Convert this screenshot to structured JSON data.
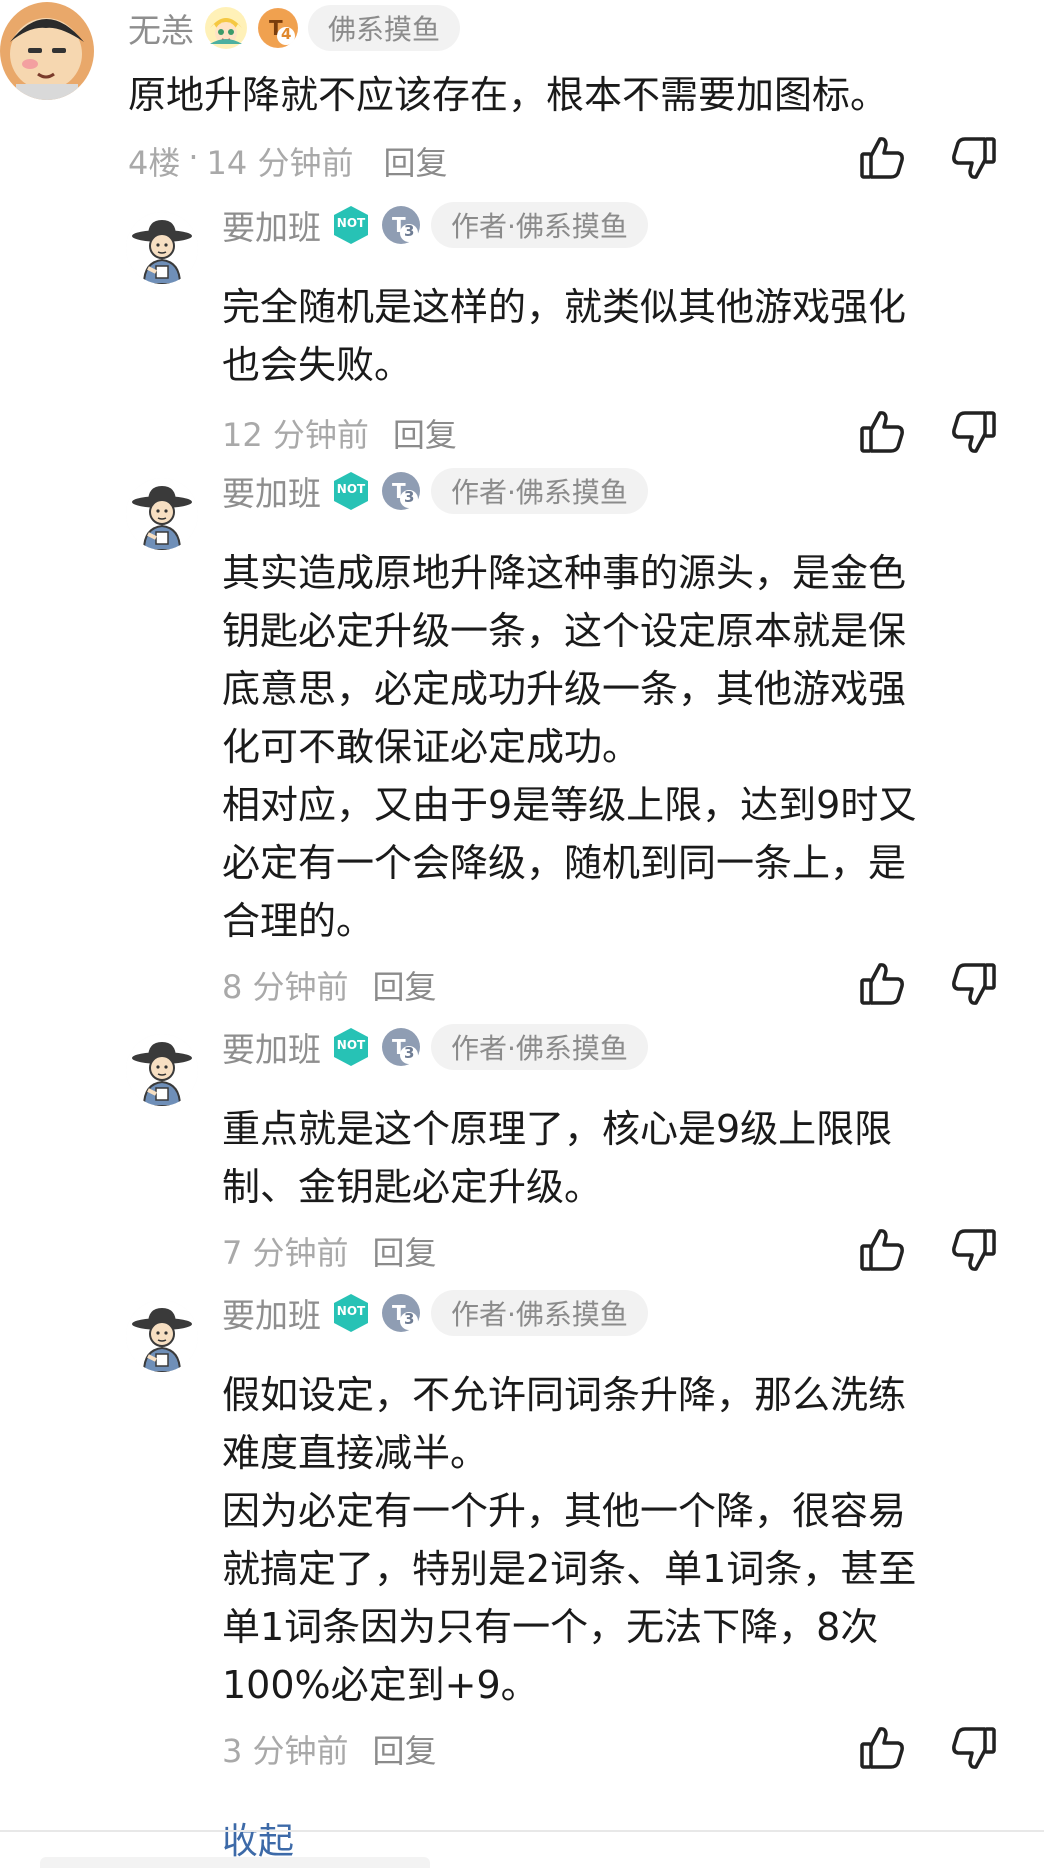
{
  "main_comment": {
    "author": "无恙",
    "tag": "佛系摸鱼",
    "lv_number": "4",
    "text": "原地升降就不应该存在，根本不需要加图标。",
    "floor": "4楼",
    "dot": "·",
    "time": "14 分钟前",
    "reply_label": "回复"
  },
  "replies": [
    {
      "author": "要加班",
      "badge_text": "NOT",
      "lv_number": "3",
      "tag": "作者·佛系摸鱼",
      "lines": [
        "完全随机是这样的，就类似其他游戏强化",
        "也会失败。"
      ],
      "time": "12 分钟前",
      "reply_label": "回复"
    },
    {
      "author": "要加班",
      "badge_text": "NOT",
      "lv_number": "3",
      "tag": "作者·佛系摸鱼",
      "lines": [
        "其实造成原地升降这种事的源头，是金色",
        "钥匙必定升级一条，这个设定原本就是保",
        "底意思，必定成功升级一条，其他游戏强",
        "化可不敢保证必定成功。",
        "相对应，又由于9是等级上限，达到9时又",
        "必定有一个会降级，随机到同一条上，是",
        "合理的。"
      ],
      "time": "8 分钟前",
      "reply_label": "回复"
    },
    {
      "author": "要加班",
      "badge_text": "NOT",
      "lv_number": "3",
      "tag": "作者·佛系摸鱼",
      "lines": [
        "重点就是这个原理了，核心是9级上限限",
        "制、金钥匙必定升级。"
      ],
      "time": "7 分钟前",
      "reply_label": "回复"
    },
    {
      "author": "要加班",
      "badge_text": "NOT",
      "lv_number": "3",
      "tag": "作者·佛系摸鱼",
      "lines": [
        "假如设定，不允许同词条升降，那么洗练",
        "难度直接减半。",
        "因为必定有一个升，其他一个降，很容易",
        "就搞定了，特别是2词条、单1词条，甚至",
        "单1词条因为只有一个，无法下降，8次",
        "100%必定到+9。"
      ],
      "time": "3 分钟前",
      "reply_label": "回复"
    }
  ],
  "collapse_label": "收起",
  "icons": {
    "like": "thumbs-up-icon",
    "dislike": "thumbs-down-icon"
  },
  "colors": {
    "meta": "#a9a9a9",
    "name": "#8e8e8e",
    "collapse": "#3d6aa8",
    "not_badge": "#27c2b5"
  }
}
